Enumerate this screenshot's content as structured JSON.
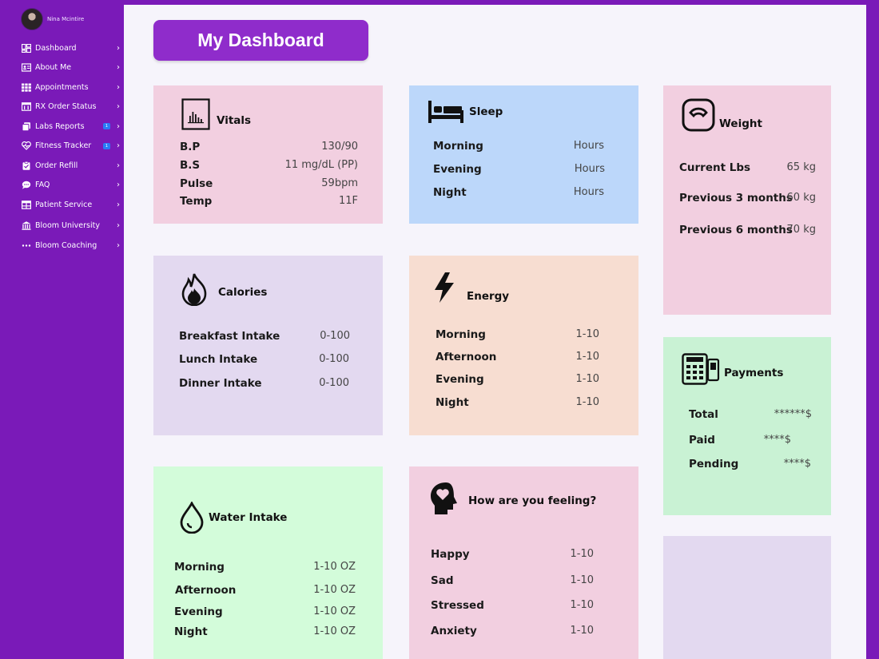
{
  "user": {
    "name": "Nina Mcintire"
  },
  "sidebar": {
    "items": [
      {
        "label": "Dashboard",
        "icon": "dashboard-icon",
        "badge": ""
      },
      {
        "label": "About Me",
        "icon": "id-card-icon",
        "badge": ""
      },
      {
        "label": "Appointments",
        "icon": "grid-icon",
        "badge": ""
      },
      {
        "label": "RX Order Status",
        "icon": "rx-icon",
        "badge": ""
      },
      {
        "label": "Labs Reports",
        "icon": "copy-icon",
        "badge": "1"
      },
      {
        "label": "Fitness Tracker",
        "icon": "heartbeat-icon",
        "badge": "1"
      },
      {
        "label": "Order Refill",
        "icon": "clipboard-icon",
        "badge": ""
      },
      {
        "label": "FAQ",
        "icon": "chat-icon",
        "badge": ""
      },
      {
        "label": "Patient Service",
        "icon": "window-icon",
        "badge": ""
      },
      {
        "label": "Bloom University",
        "icon": "university-icon",
        "badge": ""
      },
      {
        "label": "Bloom Coaching",
        "icon": "dots-icon",
        "badge": ""
      }
    ]
  },
  "page": {
    "title": "My Dashboard"
  },
  "cards": {
    "vitals": {
      "title": "Vitals",
      "rows": [
        {
          "label": "B.P",
          "value": "130/90"
        },
        {
          "label": "B.S",
          "value": "11 mg/dL (PP)"
        },
        {
          "label": "Pulse",
          "value": "59bpm"
        },
        {
          "label": "Temp",
          "value": "11F"
        }
      ]
    },
    "sleep": {
      "title": "Sleep",
      "rows": [
        {
          "label": "Morning",
          "value": "Hours"
        },
        {
          "label": "Evening",
          "value": "Hours"
        },
        {
          "label": "Night",
          "value": "Hours"
        }
      ]
    },
    "weight": {
      "title": "Weight",
      "rows": [
        {
          "label": "Current Lbs",
          "value": "65 kg"
        },
        {
          "label": "Previous 3 months",
          "value": "60 kg"
        },
        {
          "label": "Previous 6 months",
          "value": "70 kg"
        }
      ]
    },
    "calories": {
      "title": "Calories",
      "rows": [
        {
          "label": "Breakfast Intake",
          "value": "0-100"
        },
        {
          "label": "Lunch Intake",
          "value": "0-100"
        },
        {
          "label": "Dinner Intake",
          "value": "0-100"
        }
      ]
    },
    "energy": {
      "title": "Energy",
      "rows": [
        {
          "label": "Morning",
          "value": "1-10"
        },
        {
          "label": "Afternoon",
          "value": "1-10"
        },
        {
          "label": "Evening",
          "value": "1-10"
        },
        {
          "label": "Night",
          "value": "1-10"
        }
      ]
    },
    "payments": {
      "title": "Payments",
      "rows": [
        {
          "label": "Total",
          "value": "******$"
        },
        {
          "label": "Paid",
          "value": "****$"
        },
        {
          "label": "Pending",
          "value": "****$"
        }
      ]
    },
    "water": {
      "title": "Water Intake",
      "rows": [
        {
          "label": "Morning",
          "value": "1-10 OZ"
        },
        {
          "label": "Afternoon",
          "value": "1-10 OZ"
        },
        {
          "label": "Evening",
          "value": "1-10 OZ"
        },
        {
          "label": "Night",
          "value": "1-10 OZ"
        }
      ]
    },
    "feeling": {
      "title": "How are you feeling?",
      "rows": [
        {
          "label": "Happy",
          "value": "1-10"
        },
        {
          "label": "Sad",
          "value": "1-10"
        },
        {
          "label": "Stressed",
          "value": "1-10"
        },
        {
          "label": "Anxiety",
          "value": "1-10"
        }
      ]
    }
  },
  "colors": {
    "sidebar": "#7a1ab8",
    "title_button": "#8f2ccb",
    "vitals_card": "#f2cfe0",
    "sleep_card": "#bcd7fa",
    "weight_card": "#f2cfe0",
    "calories_card": "#e3d9f0",
    "energy_card": "#f7ddd1",
    "payments_card": "#c9f2d4",
    "water_card": "#d3fcda",
    "feeling_card": "#f2cfe0",
    "empty_card": "#e3d9f0"
  }
}
